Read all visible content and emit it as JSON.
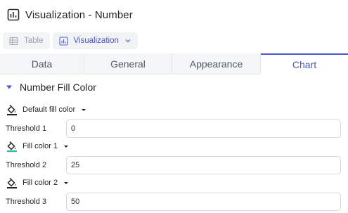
{
  "window": {
    "title": "Visualization - Number",
    "title_icon": "bar-chart-icon"
  },
  "viewbar": {
    "table_label": "Table",
    "table_icon": "table-icon",
    "visualization_label": "Visualization",
    "visualization_icon": "bar-chart-icon"
  },
  "tabs": [
    {
      "label": "Data",
      "active": false
    },
    {
      "label": "General",
      "active": false
    },
    {
      "label": "Appearance",
      "active": false
    },
    {
      "label": "Chart",
      "active": true
    }
  ],
  "section": {
    "label": "Number Fill Color",
    "expanded": true
  },
  "fill_colors": [
    {
      "label": "Default fill color",
      "color": "#1f2328"
    },
    {
      "label": "Fill color 1",
      "color": "#35b5a6"
    },
    {
      "label": "Fill color 2",
      "color": "#1f2328"
    }
  ],
  "thresholds": [
    {
      "label": "Threshold 1",
      "value": "0"
    },
    {
      "label": "Threshold 2",
      "value": "25"
    },
    {
      "label": "Threshold 3",
      "value": "50"
    }
  ],
  "colors": {
    "accent": "#4b57c9",
    "tab_bg": "#f3f5f8"
  }
}
